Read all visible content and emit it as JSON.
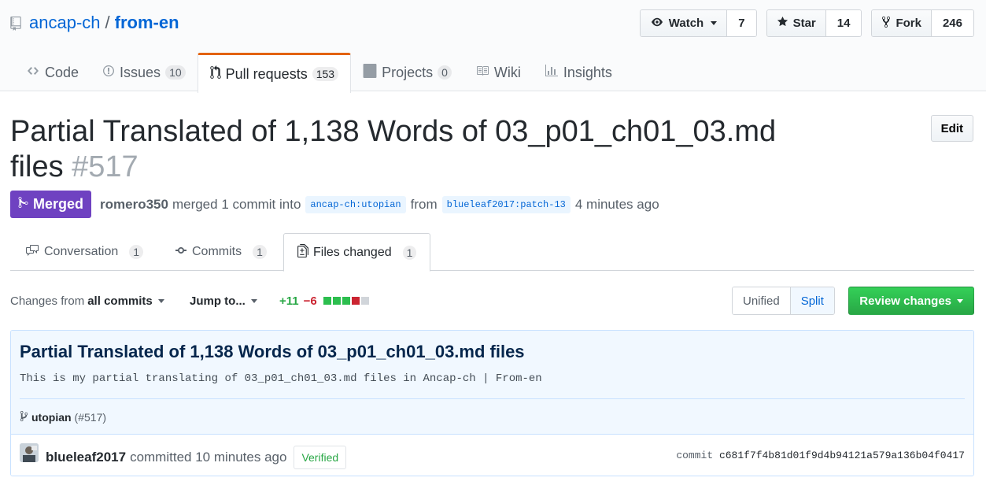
{
  "repo": {
    "owner": "ancap-ch",
    "separator": "/",
    "name": "from-en"
  },
  "actions": {
    "watch": {
      "label": "Watch",
      "count": "7"
    },
    "star": {
      "label": "Star",
      "count": "14"
    },
    "fork": {
      "label": "Fork",
      "count": "246"
    }
  },
  "nav": [
    {
      "label": "Code",
      "icon": "code-icon"
    },
    {
      "label": "Issues",
      "count": "10",
      "icon": "issue-icon"
    },
    {
      "label": "Pull requests",
      "count": "153",
      "icon": "pull-request-icon",
      "selected": true
    },
    {
      "label": "Projects",
      "count": "0",
      "icon": "project-icon"
    },
    {
      "label": "Wiki",
      "icon": "book-icon"
    },
    {
      "label": "Insights",
      "icon": "graph-icon"
    }
  ],
  "pr": {
    "title": "Partial Translated of 1,138 Words of 03_p01_ch01_03.md files",
    "number": "#517",
    "edit_label": "Edit",
    "state": "Merged",
    "author": "romero350",
    "action_text": "merged 1 commit into",
    "base_branch": "ancap-ch:utopian",
    "from_text": "from",
    "head_branch": "blueleaf2017:patch-13",
    "time": "4 minutes ago"
  },
  "tabs": [
    {
      "label": "Conversation",
      "count": "1",
      "icon": "comment-discussion-icon"
    },
    {
      "label": "Commits",
      "count": "1",
      "icon": "git-commit-icon"
    },
    {
      "label": "Files changed",
      "count": "1",
      "icon": "diff-icon",
      "selected": true
    }
  ],
  "toolbar": {
    "changes_prefix": "Changes from",
    "changes_value": "all commits",
    "jump": "Jump to...",
    "additions": "+11",
    "deletions": "−6",
    "unified": "Unified",
    "split": "Split",
    "review": "Review changes"
  },
  "diffstat_colors": [
    "#2cbe4e",
    "#2cbe4e",
    "#2cbe4e",
    "#cb2431",
    "#d1d5da"
  ],
  "commit": {
    "title": "Partial Translated of 1,138 Words of 03_p01_ch01_03.md files",
    "description": "This is my partial translating of 03_p01_ch01_03.md files in Ancap-ch | From-en",
    "branch": "utopian",
    "branch_ref": "(#517)",
    "author": "blueleaf2017",
    "committed_text": "committed 10 minutes ago",
    "verified": "Verified",
    "sha_prefix": "commit",
    "sha": "c681f7f4b81d01f9d4b94121a579a136b04f0417"
  }
}
